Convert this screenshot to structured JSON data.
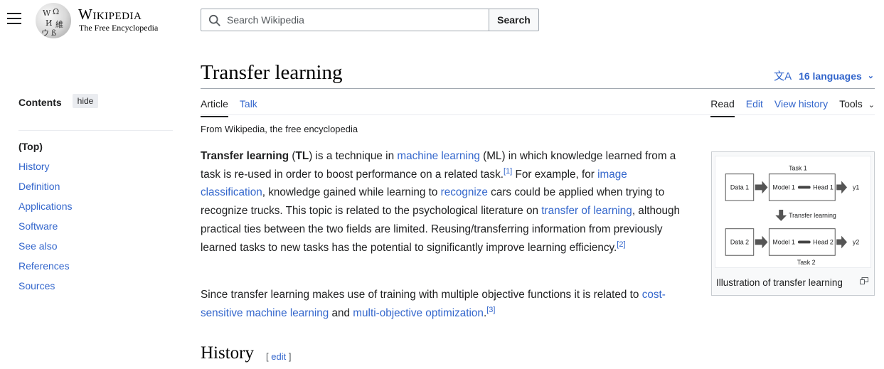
{
  "header": {
    "wordmark": "Wikipedia",
    "tagline": "The Free Encyclopedia",
    "search_placeholder": "Search Wikipedia",
    "search_button": "Search"
  },
  "toc": {
    "title": "Contents",
    "hide_label": "hide",
    "items": [
      "(Top)",
      "History",
      "Definition",
      "Applications",
      "Software",
      "See also",
      "References",
      "Sources"
    ]
  },
  "page": {
    "title": "Transfer learning",
    "languages": "16 languages",
    "tabs_left": [
      "Article",
      "Talk"
    ],
    "tabs_right": [
      "Read",
      "Edit",
      "View history"
    ],
    "tools": "Tools",
    "from": "From Wikipedia, the free encyclopedia"
  },
  "p1": {
    "term": "Transfer learning",
    "open": " (",
    "abbr": "TL",
    "t1": ") is a technique in ",
    "l1": "machine learning",
    "t2": " (ML) in which knowledge learned from a task is re-used in order to boost performance on a related task.",
    "ref1": "[1]",
    "t3": " For example, for ",
    "l2": "image classification",
    "t4": ", knowledge gained while learning to ",
    "l3": "recognize",
    "t5": " cars could be applied when trying to recognize trucks. This topic is related to the psychological literature on ",
    "l4": "transfer of learning",
    "t6": ", although practical ties between the two fields are limited. Reusing/transferring information from previously learned tasks to new tasks has the potential to significantly improve learning efficiency.",
    "ref2": "[2]"
  },
  "p2": {
    "t1": "Since transfer learning makes use of training with multiple objective functions it is related to ",
    "l1": "cost-sensitive machine learning",
    "t2": " and ",
    "l2": "multi-objective optimization",
    "t3": ".",
    "ref3": "[3]"
  },
  "figure": {
    "caption": "Illustration of transfer learning",
    "task1": "Task 1",
    "task2": "Task 2",
    "data1": "Data 1",
    "data2": "Data 2",
    "model1a": "Model 1",
    "model1b": "Model 1",
    "head1": "Head 1",
    "head2": "Head 2",
    "y1": "y1",
    "y2": "y2",
    "transfer": "Transfer learning"
  },
  "history": {
    "heading": "History",
    "edit_open": "[ ",
    "edit": "edit",
    "edit_close": " ]"
  },
  "icons": {
    "menu": "hamburger-icon",
    "search": "search-icon",
    "language": "translate-icon",
    "enlarge": "enlarge-icon"
  },
  "colors": {
    "link": "#3366cc",
    "text": "#202122",
    "border": "#a2a9b1"
  }
}
